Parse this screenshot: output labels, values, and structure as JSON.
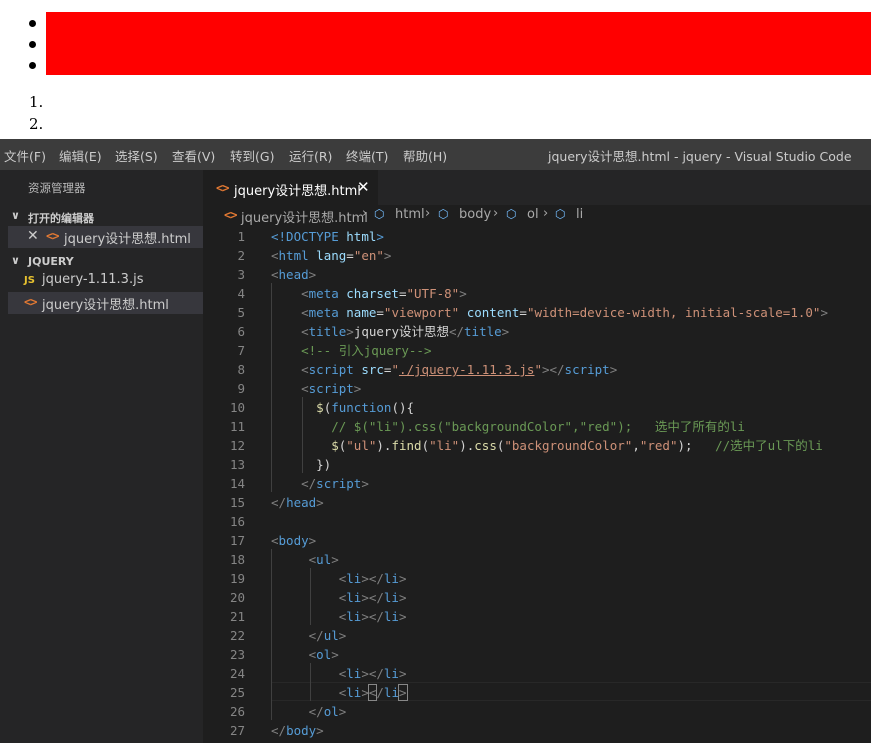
{
  "menubar": {
    "items": [
      "文件(F)",
      "编辑(E)",
      "选择(S)",
      "查看(V)",
      "转到(G)",
      "运行(R)",
      "终端(T)",
      "帮助(H)"
    ],
    "window_title": "jquery设计思想.html - jquery - Visual Studio Code"
  },
  "preview": {
    "ol_numbers": [
      "1.",
      "2."
    ]
  },
  "sidebar": {
    "title": "资源管理器",
    "open_editors_label": "打开的编辑器",
    "open_editors": [
      {
        "name": "jquery设计思想.html"
      }
    ],
    "folder_label": "JQUERY",
    "files": [
      {
        "name": "jquery-1.11.3.js",
        "icon_text": "JS"
      },
      {
        "name": "jquery设计思想.html",
        "icon_text": "<>"
      }
    ]
  },
  "tab": {
    "label": "jquery设计思想.html",
    "icon_text": "<>"
  },
  "breadcrumb": {
    "file": "jquery设计思想.html",
    "items": [
      "html",
      "body",
      "ol",
      "li"
    ]
  },
  "editor": {
    "line_numbers": [
      "1",
      "2",
      "3",
      "4",
      "5",
      "6",
      "7",
      "8",
      "9",
      "10",
      "11",
      "12",
      "13",
      "14",
      "15",
      "16",
      "17",
      "18",
      "19",
      "20",
      "21",
      "22",
      "23",
      "24",
      "25",
      "26",
      "27"
    ],
    "lines": [
      [
        [
          "tag",
          "<!DOCTYPE "
        ],
        [
          "attr",
          "html"
        ],
        [
          "tag",
          ">"
        ]
      ],
      [
        [
          "punc",
          "<"
        ],
        [
          "tag",
          "html"
        ],
        [
          "txt",
          " "
        ],
        [
          "attr",
          "lang"
        ],
        [
          "txt",
          "="
        ],
        [
          "str",
          "\"en\""
        ],
        [
          "punc",
          ">"
        ]
      ],
      [
        [
          "punc",
          "<"
        ],
        [
          "tag",
          "head"
        ],
        [
          "punc",
          ">"
        ]
      ],
      [
        [
          "txt",
          "    "
        ],
        [
          "punc",
          "<"
        ],
        [
          "tag",
          "meta"
        ],
        [
          "txt",
          " "
        ],
        [
          "attr",
          "charset"
        ],
        [
          "txt",
          "="
        ],
        [
          "str",
          "\"UTF-8\""
        ],
        [
          "punc",
          ">"
        ]
      ],
      [
        [
          "txt",
          "    "
        ],
        [
          "punc",
          "<"
        ],
        [
          "tag",
          "meta"
        ],
        [
          "txt",
          " "
        ],
        [
          "attr",
          "name"
        ],
        [
          "txt",
          "="
        ],
        [
          "str",
          "\"viewport\""
        ],
        [
          "txt",
          " "
        ],
        [
          "attr",
          "content"
        ],
        [
          "txt",
          "="
        ],
        [
          "str",
          "\"width=device-width, initial-scale=1.0\""
        ],
        [
          "punc",
          ">"
        ]
      ],
      [
        [
          "txt",
          "    "
        ],
        [
          "punc",
          "<"
        ],
        [
          "tag",
          "title"
        ],
        [
          "punc",
          ">"
        ],
        [
          "txt",
          "jquery设计思想"
        ],
        [
          "punc",
          "</"
        ],
        [
          "tag",
          "title"
        ],
        [
          "punc",
          ">"
        ]
      ],
      [
        [
          "txt",
          "    "
        ],
        [
          "com",
          "<!-- 引入jquery-->"
        ]
      ],
      [
        [
          "txt",
          "    "
        ],
        [
          "punc",
          "<"
        ],
        [
          "tag",
          "script"
        ],
        [
          "txt",
          " "
        ],
        [
          "attr",
          "src"
        ],
        [
          "txt",
          "="
        ],
        [
          "str",
          "\""
        ],
        [
          "link",
          "./jquery-1.11.3.js"
        ],
        [
          "str",
          "\""
        ],
        [
          "punc",
          "></"
        ],
        [
          "tag",
          "script"
        ],
        [
          "punc",
          ">"
        ]
      ],
      [
        [
          "txt",
          "    "
        ],
        [
          "punc",
          "<"
        ],
        [
          "tag",
          "script"
        ],
        [
          "punc",
          ">"
        ]
      ],
      [
        [
          "txt",
          "      "
        ],
        [
          "fn",
          "$"
        ],
        [
          "txt",
          "("
        ],
        [
          "kw",
          "function"
        ],
        [
          "txt",
          "(){"
        ]
      ],
      [
        [
          "txt",
          "        "
        ],
        [
          "com",
          "// $(\"li\").css(\"backgroundColor\",\"red\");   选中了所有的li"
        ]
      ],
      [
        [
          "txt",
          "        "
        ],
        [
          "fn",
          "$"
        ],
        [
          "txt",
          "("
        ],
        [
          "str",
          "\"ul\""
        ],
        [
          "txt",
          ")."
        ],
        [
          "fn",
          "find"
        ],
        [
          "txt",
          "("
        ],
        [
          "str",
          "\"li\""
        ],
        [
          "txt",
          ")."
        ],
        [
          "fn",
          "css"
        ],
        [
          "txt",
          "("
        ],
        [
          "str",
          "\"backgroundColor\""
        ],
        [
          "txt",
          ","
        ],
        [
          "str",
          "\"red\""
        ],
        [
          "txt",
          ");   "
        ],
        [
          "com",
          "//选中了ul下的li"
        ]
      ],
      [
        [
          "txt",
          "      })"
        ]
      ],
      [
        [
          "txt",
          "    "
        ],
        [
          "punc",
          "</"
        ],
        [
          "tag",
          "script"
        ],
        [
          "punc",
          ">"
        ]
      ],
      [
        [
          "punc",
          "</"
        ],
        [
          "tag",
          "head"
        ],
        [
          "punc",
          ">"
        ]
      ],
      [
        [
          "txt",
          ""
        ]
      ],
      [
        [
          "punc",
          "<"
        ],
        [
          "tag",
          "body"
        ],
        [
          "punc",
          ">"
        ]
      ],
      [
        [
          "txt",
          "     "
        ],
        [
          "punc",
          "<"
        ],
        [
          "tag",
          "ul"
        ],
        [
          "punc",
          ">"
        ]
      ],
      [
        [
          "txt",
          "         "
        ],
        [
          "punc",
          "<"
        ],
        [
          "tag",
          "li"
        ],
        [
          "punc",
          "></"
        ],
        [
          "tag",
          "li"
        ],
        [
          "punc",
          ">"
        ]
      ],
      [
        [
          "txt",
          "         "
        ],
        [
          "punc",
          "<"
        ],
        [
          "tag",
          "li"
        ],
        [
          "punc",
          "></"
        ],
        [
          "tag",
          "li"
        ],
        [
          "punc",
          ">"
        ]
      ],
      [
        [
          "txt",
          "         "
        ],
        [
          "punc",
          "<"
        ],
        [
          "tag",
          "li"
        ],
        [
          "punc",
          "></"
        ],
        [
          "tag",
          "li"
        ],
        [
          "punc",
          ">"
        ]
      ],
      [
        [
          "txt",
          "     "
        ],
        [
          "punc",
          "</"
        ],
        [
          "tag",
          "ul"
        ],
        [
          "punc",
          ">"
        ]
      ],
      [
        [
          "txt",
          "     "
        ],
        [
          "punc",
          "<"
        ],
        [
          "tag",
          "ol"
        ],
        [
          "punc",
          ">"
        ]
      ],
      [
        [
          "txt",
          "         "
        ],
        [
          "punc",
          "<"
        ],
        [
          "tag",
          "li"
        ],
        [
          "punc",
          "></"
        ],
        [
          "tag",
          "li"
        ],
        [
          "punc",
          ">"
        ]
      ],
      [
        [
          "txt",
          "         "
        ],
        [
          "punc",
          "<"
        ],
        [
          "tag",
          "li"
        ],
        [
          "punc",
          ">"
        ],
        [
          "cur",
          "<"
        ],
        [
          "punc",
          "/"
        ],
        [
          "tag",
          "li"
        ],
        [
          "cur",
          ">"
        ]
      ],
      [
        [
          "txt",
          "     "
        ],
        [
          "punc",
          "</"
        ],
        [
          "tag",
          "ol"
        ],
        [
          "punc",
          ">"
        ]
      ],
      [
        [
          "punc",
          "</"
        ],
        [
          "tag",
          "body"
        ],
        [
          "punc",
          ">"
        ]
      ]
    ]
  },
  "colors": {
    "red_band": "#ff0000",
    "menubar_bg": "#3c3c3c",
    "sidebar_bg": "#252526",
    "editor_bg": "#1e1e1e",
    "html_icon": "#e37933",
    "js_icon": "#e8c22f",
    "breadcrumb_icon": "#75beff"
  }
}
